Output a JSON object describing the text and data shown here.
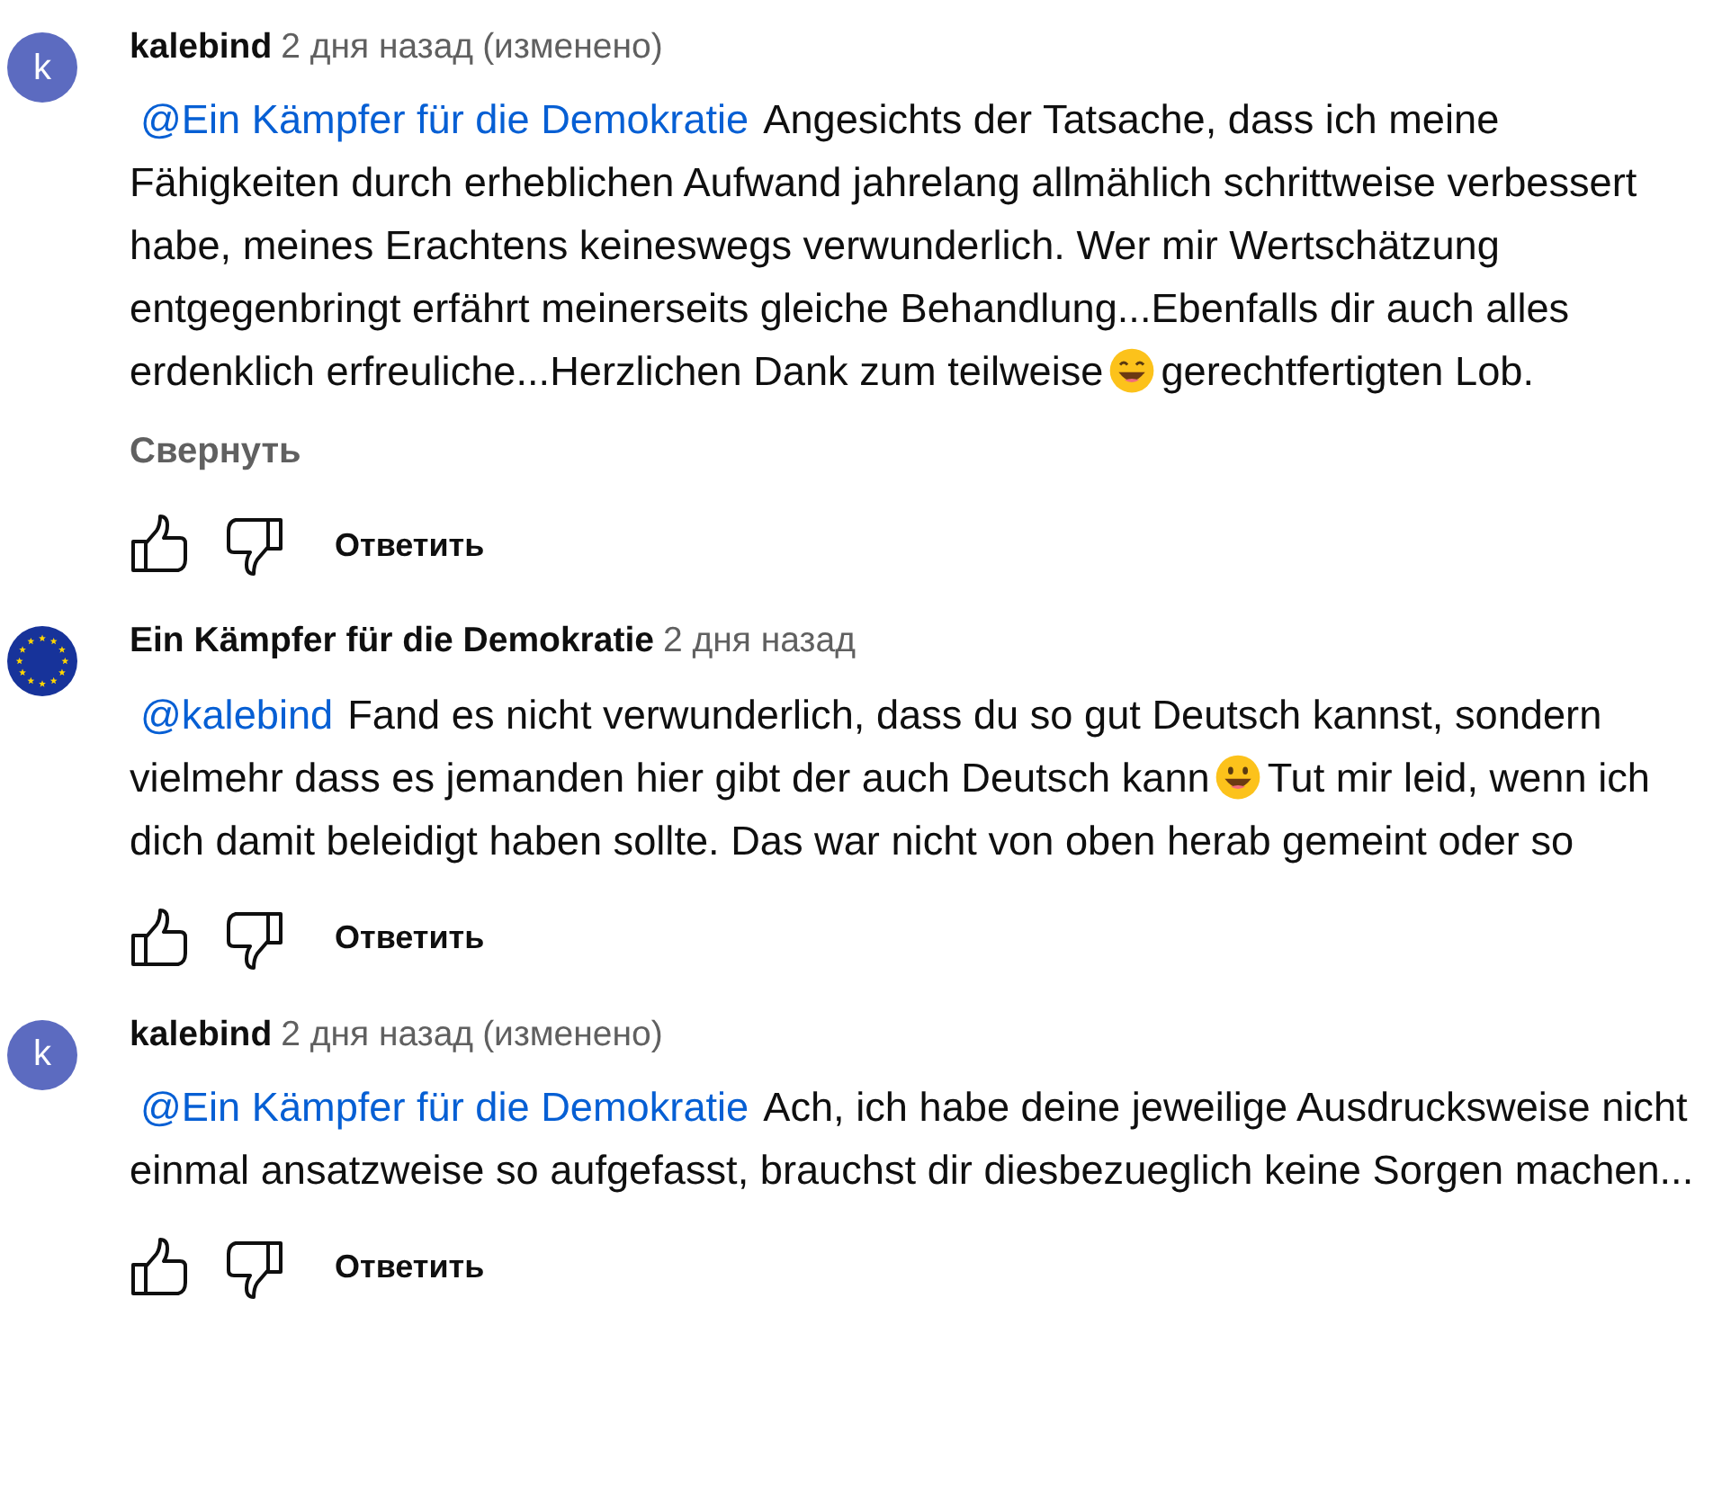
{
  "comments": [
    {
      "avatar": {
        "kind": "letter",
        "letter": "k",
        "color": "#5c6bc0"
      },
      "author": "kalebind",
      "time": "2 дня назад",
      "edited": "(изменено)",
      "body": [
        {
          "kind": "mention",
          "text": "@Ein Kämpfer für die Demokratie"
        },
        {
          "kind": "text",
          "text": "Angesichts der Tatsache, dass ich meine Fähigkeiten durch erheblichen Aufwand jahrelang allmählich schrittweise verbessert habe, meines Erachtens keineswegs verwunderlich. Wer mir Wertschätzung entgegenbringt erfährt meinerseits gleiche Behandlung...Ebenfalls dir auch alles erdenklich erfreuliche...Herzlichen Dank zum teilweise"
        },
        {
          "kind": "grin"
        },
        {
          "kind": "text",
          "text": "gerechtfertigten Lob."
        }
      ],
      "collapse": "Свернуть",
      "reply": "Ответить"
    },
    {
      "avatar": {
        "kind": "flag"
      },
      "author": "Ein Kämpfer für die Demokratie",
      "time": "2 дня назад",
      "body": [
        {
          "kind": "mention",
          "text": "@kalebind"
        },
        {
          "kind": "text",
          "text": "Fand es nicht verwunderlich, dass du so gut Deutsch kannst, sondern vielmehr dass es jemanden hier gibt der auch Deutsch kann"
        },
        {
          "kind": "smile"
        },
        {
          "kind": "text",
          "text": "Tut mir leid, wenn ich dich damit beleidigt haben sollte. Das war nicht von oben herab gemeint oder so"
        }
      ],
      "reply": "Ответить"
    },
    {
      "avatar": {
        "kind": "letter",
        "letter": "k",
        "color": "#5c6bc0"
      },
      "author": "kalebind",
      "time": "2 дня назад",
      "edited": "(изменено)",
      "body": [
        {
          "kind": "mention",
          "text": "@Ein Kämpfer für die Demokratie"
        },
        {
          "kind": "text",
          "text": "Ach, ich habe deine jeweilige Ausdrucksweise nicht einmal ansatzweise so aufgefasst, brauchst dir diesbezueglich keine Sorgen machen..."
        }
      ],
      "reply": "Ответить"
    }
  ]
}
